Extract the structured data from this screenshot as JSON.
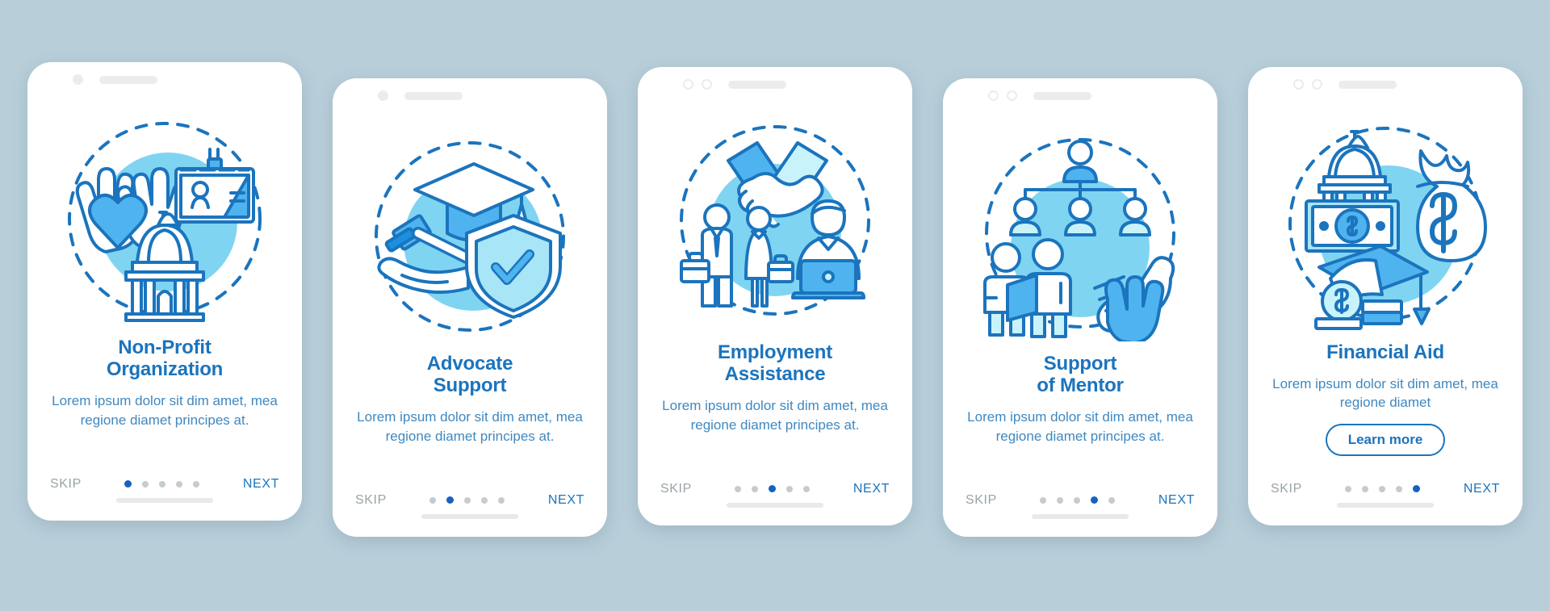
{
  "background_color": "#b8cfda",
  "theme": {
    "title_color": "#1b74bd",
    "body_color": "#3f88c0",
    "skip_color": "#9aa3a8",
    "next_color": "#1b74bd",
    "active_dot_color": "#1561c4",
    "inactive_dot_color": "#c4ccd1",
    "card_background": "#ffffff",
    "illustration_circle": "#7fd4f2",
    "illustration_stroke": "#1b74bd"
  },
  "nav_labels": {
    "skip": "SKIP",
    "next": "NEXT"
  },
  "total_steps": 5,
  "screens": [
    {
      "id": "non-profit-organization",
      "title_line1": "Non-Profit",
      "title_line2": "Organization",
      "description": "Lorem ipsum dolor sit dim amet, mea regione diamet principes at.",
      "active_index": 0,
      "skip": "SKIP",
      "next": "NEXT",
      "cta": null,
      "status_dots": 1,
      "illustration": "hands-heart-id-badge-capitol"
    },
    {
      "id": "advocate-support",
      "title_line1": "Advocate",
      "title_line2": "Support",
      "description": "Lorem ipsum dolor sit dim amet, mea regione diamet principes at.",
      "active_index": 1,
      "skip": "SKIP",
      "next": "NEXT",
      "cta": null,
      "status_dots": 1,
      "illustration": "graduation-cap-gavel-shield"
    },
    {
      "id": "employment-assistance",
      "title_line1": "Employment",
      "title_line2": "Assistance",
      "description": "Lorem ipsum dolor sit dim amet, mea regione diamet principes at.",
      "active_index": 2,
      "skip": "SKIP",
      "next": "NEXT",
      "cta": null,
      "status_dots": 2,
      "illustration": "handshake-jobseekers-laptop"
    },
    {
      "id": "support-of-mentor",
      "title_line1": "Support",
      "title_line2": "of Mentor",
      "description": "Lorem ipsum dolor sit dim amet, mea regione diamet principes at.",
      "active_index": 3,
      "skip": "SKIP",
      "next": "NEXT",
      "cta": null,
      "status_dots": 2,
      "illustration": "org-chart-people-high-five"
    },
    {
      "id": "financial-aid",
      "title_line1": "Financial Aid",
      "title_line2": "",
      "description": "Lorem ipsum dolor sit dim amet, mea regione diamet",
      "active_index": 4,
      "skip": "SKIP",
      "next": "NEXT",
      "cta": "Learn more",
      "status_dots": 2,
      "illustration": "banknote-money-bag-grad-cap-coins"
    }
  ]
}
